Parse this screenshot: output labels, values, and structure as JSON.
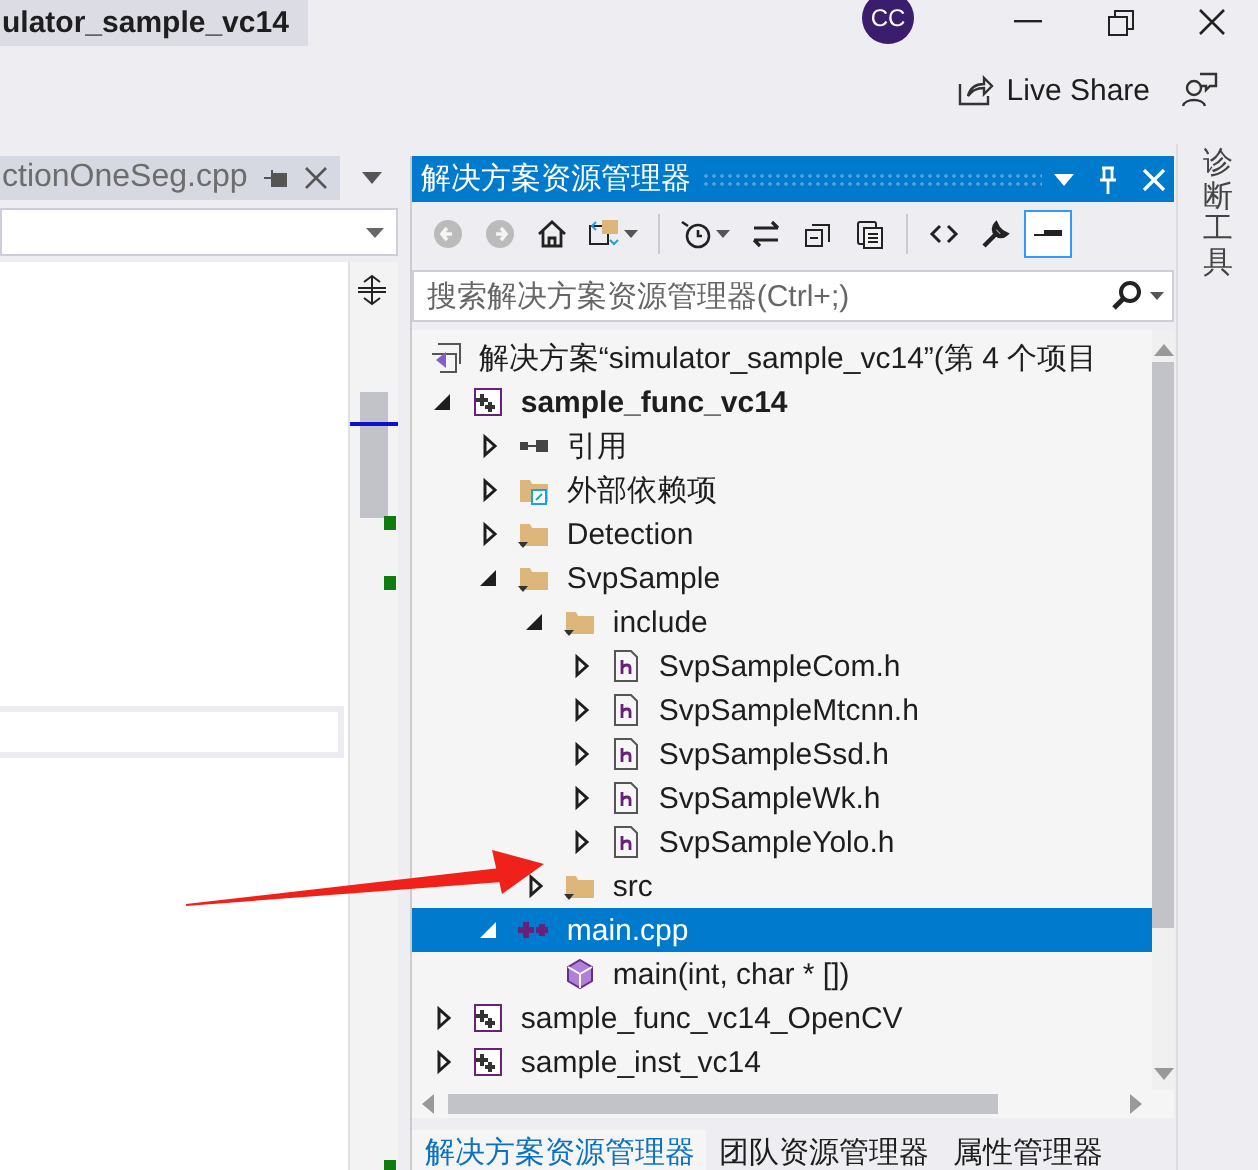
{
  "window": {
    "title": "ulator_sample_vc14",
    "account": "CC"
  },
  "live_share": {
    "label": "Live Share"
  },
  "editor": {
    "tab": {
      "label": "ctionOneSeg.cpp"
    }
  },
  "solution_explorer": {
    "title": "解决方案资源管理器",
    "toolbar": [
      {
        "kind": "back",
        "disabled": true,
        "selected": false
      },
      {
        "kind": "forward",
        "disabled": true,
        "selected": false
      },
      {
        "kind": "home",
        "disabled": false,
        "selected": false
      },
      {
        "kind": "sync",
        "disabled": false,
        "selected": false
      },
      {
        "kind": "history",
        "disabled": false,
        "selected": false
      },
      {
        "kind": "swap",
        "disabled": false,
        "selected": false
      },
      {
        "kind": "collapse",
        "disabled": false,
        "selected": false
      },
      {
        "kind": "copy",
        "disabled": false,
        "selected": false
      },
      {
        "kind": "code",
        "disabled": false,
        "selected": false
      },
      {
        "kind": "properties",
        "disabled": false,
        "selected": false
      },
      {
        "kind": "preview",
        "disabled": false,
        "selected": true
      }
    ],
    "search": {
      "placeholder": "搜索解决方案资源管理器(Ctrl+;)"
    },
    "solution": {
      "label": "解决方案“simulator_sample_vc14”(第 4 个项目"
    },
    "projects": [
      {
        "label": "sample_func_vc14",
        "kind": "project",
        "startup": true,
        "expanded": true,
        "selected": false,
        "children": [
          {
            "label": "引用",
            "kind": "references",
            "expanded": false,
            "selected": false
          },
          {
            "label": "外部依赖项",
            "kind": "external",
            "expanded": false,
            "selected": false
          },
          {
            "label": "Detection",
            "kind": "filter",
            "expanded": false,
            "selected": false
          },
          {
            "label": "SvpSample",
            "kind": "filter",
            "expanded": true,
            "selected": false,
            "children": [
              {
                "label": "include",
                "kind": "filter",
                "expanded": true,
                "selected": false,
                "children": [
                  {
                    "label": "SvpSampleCom.h",
                    "kind": "header",
                    "expanded": false,
                    "selected": false
                  },
                  {
                    "label": "SvpSampleMtcnn.h",
                    "kind": "header",
                    "expanded": false,
                    "selected": false
                  },
                  {
                    "label": "SvpSampleSsd.h",
                    "kind": "header",
                    "expanded": false,
                    "selected": false
                  },
                  {
                    "label": "SvpSampleWk.h",
                    "kind": "header",
                    "expanded": false,
                    "selected": false
                  },
                  {
                    "label": "SvpSampleYolo.h",
                    "kind": "header",
                    "expanded": false,
                    "selected": false
                  }
                ]
              },
              {
                "label": "src",
                "kind": "filter",
                "expanded": false,
                "selected": false
              }
            ]
          },
          {
            "label": "main.cpp",
            "kind": "cpp",
            "expanded": true,
            "selected": true,
            "children": [
              {
                "label": "main(int, char * [])",
                "kind": "function",
                "selected": false
              }
            ]
          }
        ]
      },
      {
        "label": "sample_func_vc14_OpenCV",
        "kind": "project",
        "startup": false,
        "expanded": false,
        "selected": false
      },
      {
        "label": "sample_inst_vc14",
        "kind": "project",
        "startup": false,
        "expanded": false,
        "selected": false
      }
    ],
    "bottom_tabs": [
      {
        "label": "解决方案资源管理器",
        "selected": true
      },
      {
        "label": "团队资源管理器",
        "selected": false
      },
      {
        "label": "属性管理器",
        "selected": false
      }
    ]
  },
  "side_tab": {
    "label": "诊断工具"
  }
}
